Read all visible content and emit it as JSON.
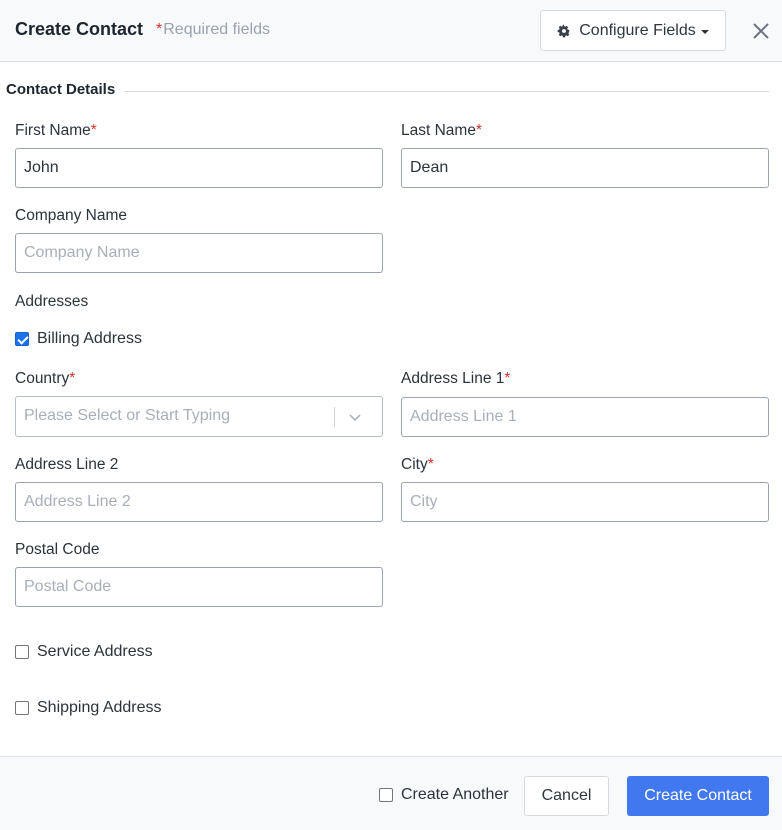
{
  "header": {
    "title": "Create Contact",
    "required_star": "*",
    "required_note": "Required fields",
    "configure_button": "Configure Fields",
    "configure_icon": "gear-icon",
    "close_icon": "close-icon"
  },
  "section": {
    "title": "Contact Details"
  },
  "fields": {
    "first_name": {
      "label": "First Name",
      "required": "*",
      "value": "John",
      "placeholder": ""
    },
    "last_name": {
      "label": "Last Name",
      "required": "*",
      "value": "Dean",
      "placeholder": ""
    },
    "company_name": {
      "label": "Company Name",
      "value": "",
      "placeholder": "Company Name"
    },
    "country": {
      "label": "Country",
      "required": "*",
      "placeholder": "Please Select or Start Typing"
    },
    "address_line_1": {
      "label": "Address Line 1",
      "required": "*",
      "value": "",
      "placeholder": "Address Line 1"
    },
    "address_line_2": {
      "label": "Address Line 2",
      "value": "",
      "placeholder": "Address Line 2"
    },
    "city": {
      "label": "City",
      "required": "*",
      "value": "",
      "placeholder": "City"
    },
    "postal_code": {
      "label": "Postal Code",
      "value": "",
      "placeholder": "Postal Code"
    }
  },
  "addresses": {
    "label": "Addresses",
    "billing": {
      "label": "Billing Address",
      "checked": true
    },
    "service": {
      "label": "Service Address",
      "checked": false
    },
    "shipping": {
      "label": "Shipping Address",
      "checked": false
    }
  },
  "footer": {
    "create_another": {
      "label": "Create Another",
      "checked": false
    },
    "cancel": "Cancel",
    "create": "Create Contact"
  },
  "colors": {
    "primary": "#4178f0",
    "required": "#d0342c"
  }
}
